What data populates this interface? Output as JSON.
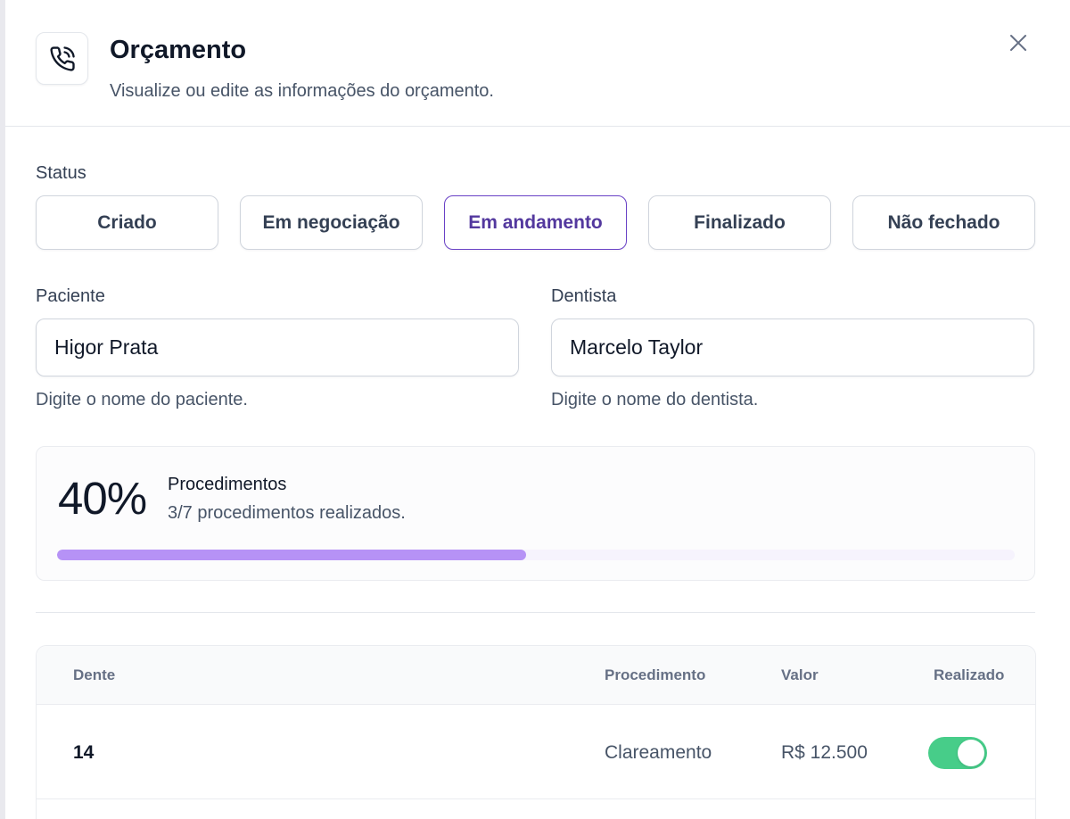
{
  "header": {
    "icon": "phone-call-icon",
    "title": "Orçamento",
    "subtitle": "Visualize ou edite as informações do orçamento.",
    "close_icon": "close-icon"
  },
  "status": {
    "label": "Status",
    "options": [
      "Criado",
      "Em negociação",
      "Em andamento",
      "Finalizado",
      "Não fechado"
    ],
    "selected": "Em andamento"
  },
  "paciente": {
    "label": "Paciente",
    "value": "Higor Prata",
    "hint": "Digite o nome do paciente."
  },
  "dentista": {
    "label": "Dentista",
    "value": "Marcelo Taylor",
    "hint": "Digite o nome do dentista."
  },
  "progress": {
    "percent_label": "40%",
    "title": "Procedimentos",
    "subtitle": "3/7 procedimentos realizados.",
    "fill_fraction": 0.49
  },
  "table": {
    "columns": [
      "Dente",
      "Procedimento",
      "Valor",
      "Realizado"
    ],
    "rows": [
      {
        "dente": "14",
        "procedimento": "Clareamento",
        "valor": "R$ 12.500",
        "realizado": true
      }
    ]
  },
  "colors": {
    "accent": "#6941c6",
    "progress_fill": "#b692f6",
    "toggle_on": "#47cd89"
  }
}
